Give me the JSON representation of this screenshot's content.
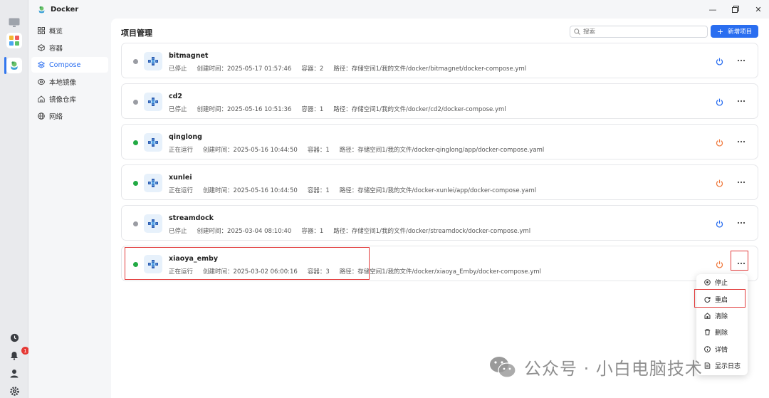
{
  "window": {
    "title": "Docker"
  },
  "sidebar": {
    "items": [
      {
        "label": "概览",
        "icon": "grid-icon"
      },
      {
        "label": "容器",
        "icon": "cube-icon"
      },
      {
        "label": "Compose",
        "icon": "layers-icon",
        "active": true
      },
      {
        "label": "本地镜像",
        "icon": "disc-icon"
      },
      {
        "label": "镜像仓库",
        "icon": "home-icon"
      },
      {
        "label": "网络",
        "icon": "globe-icon"
      }
    ]
  },
  "header": {
    "title": "项目管理",
    "search_placeholder": "搜索",
    "new_button": "新增项目"
  },
  "projects": [
    {
      "name": "bitmagnet",
      "status": "已停止",
      "running": false,
      "created_label": "创建时间：",
      "created": "2025-05-17 01:57:46",
      "containers_label": "容器：",
      "containers": "2",
      "path_label": "路径：",
      "path": "存储空间1/我的文件/docker/bitmagnet/docker-compose.yml"
    },
    {
      "name": "cd2",
      "status": "已停止",
      "running": false,
      "created_label": "创建时间：",
      "created": "2025-05-16 10:51:36",
      "containers_label": "容器：",
      "containers": "1",
      "path_label": "路径：",
      "path": "存储空间1/我的文件/docker/cd2/docker-compose.yml"
    },
    {
      "name": "qinglong",
      "status": "正在运行",
      "running": true,
      "created_label": "创建时间：",
      "created": "2025-05-16 10:44:50",
      "containers_label": "容器：",
      "containers": "1",
      "path_label": "路径：",
      "path": "存储空间1/我的文件/docker-qinglong/app/docker-compose.yaml"
    },
    {
      "name": "xunlei",
      "status": "正在运行",
      "running": true,
      "created_label": "创建时间：",
      "created": "2025-05-16 10:44:50",
      "containers_label": "容器：",
      "containers": "1",
      "path_label": "路径：",
      "path": "存储空间1/我的文件/docker-xunlei/app/docker-compose.yaml"
    },
    {
      "name": "streamdock",
      "status": "已停止",
      "running": false,
      "created_label": "创建时间：",
      "created": "2025-03-04 08:10:40",
      "containers_label": "容器：",
      "containers": "1",
      "path_label": "路径：",
      "path": "存储空间1/我的文件/docker/streamdock/docker-compose.yml"
    },
    {
      "name": "xiaoya_emby",
      "status": "正在运行",
      "running": true,
      "created_label": "创建时间：",
      "created": "2025-03-02 06:00:16",
      "containers_label": "容器：",
      "containers": "3",
      "path_label": "路径：",
      "path": "存储空间1/我的文件/docker/xiaoya_Emby/docker-compose.yml"
    }
  ],
  "context_menu": {
    "items": [
      {
        "label": "停止",
        "icon": "stop-icon"
      },
      {
        "label": "重启",
        "icon": "restart-icon"
      },
      {
        "label": "清除",
        "icon": "clean-icon"
      },
      {
        "label": "删除",
        "icon": "trash-icon"
      },
      {
        "label": "详情",
        "icon": "info-icon"
      },
      {
        "label": "显示日志",
        "icon": "log-icon"
      }
    ]
  },
  "notifications": {
    "count": "1"
  },
  "watermark": {
    "text": "公众号 · 小白电脑技术"
  },
  "colors": {
    "accent": "#2a6ef0",
    "running": "#22aa44",
    "stopped": "#9a9ca3",
    "power_running": "#f07b3f",
    "power_stopped": "#2a6ef0",
    "highlight": "#e23b3b"
  }
}
